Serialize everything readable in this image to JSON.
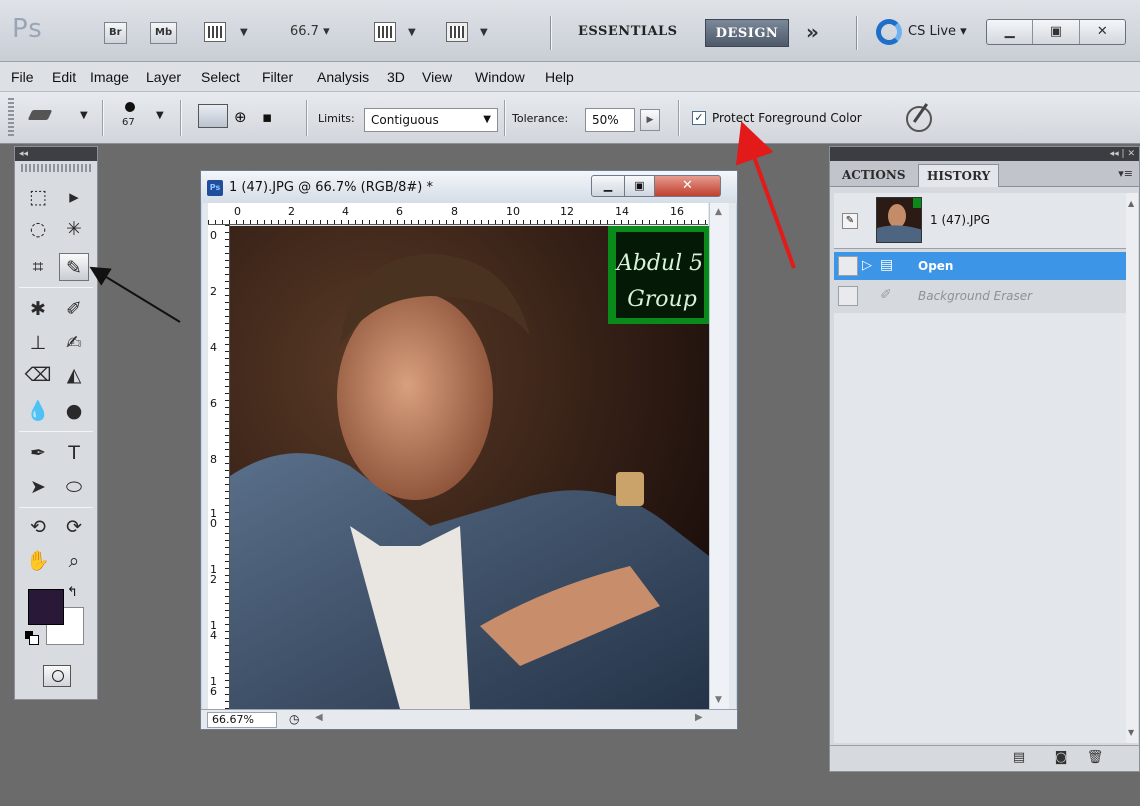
{
  "appbar": {
    "logo": "Ps",
    "bridge": "Br",
    "minibridge": "Mb",
    "zoom": "66.7 ▾",
    "workspace_essentials": "ESSENTIALS",
    "workspace_design": "DESIGN",
    "more_workspaces": "»",
    "cs_live": "CS Live ▾"
  },
  "menu": [
    "File",
    "Edit",
    "Image",
    "Layer",
    "Select",
    "Filter",
    "Analysis",
    "3D",
    "View",
    "Window",
    "Help"
  ],
  "options": {
    "brush_size": "67",
    "limits_label": "Limits:",
    "limits_value": "Contiguous",
    "tolerance_label": "Tolerance:",
    "tolerance_value": "50%",
    "protect_fg_label": "Protect Foreground Color",
    "protect_fg_checked": true
  },
  "toolbox": {
    "collapse": "◂◂",
    "fg_color": "#2a1838",
    "bg_color": "#ffffff"
  },
  "document": {
    "title": "1 (47).JPG @ 66.7% (RGB/8#) *",
    "zoom_status": "66.67%",
    "ruler_top": [
      "0",
      "2",
      "4",
      "6",
      "8",
      "10",
      "12",
      "14",
      "16"
    ],
    "ruler_left": [
      "0",
      "2",
      "4",
      "6",
      "8",
      "10",
      "12",
      "14",
      "16"
    ],
    "watermark_line1": "Abdul 5",
    "watermark_line2": "Group"
  },
  "history_panel": {
    "collapse": "◂◂ | ✕",
    "tab_actions": "ACTIONS",
    "tab_history": "HISTORY",
    "snapshot_name": "1 (47).JPG",
    "states": [
      {
        "label": "Open",
        "selected": true
      },
      {
        "label": "Background Eraser",
        "selected": false
      }
    ]
  }
}
